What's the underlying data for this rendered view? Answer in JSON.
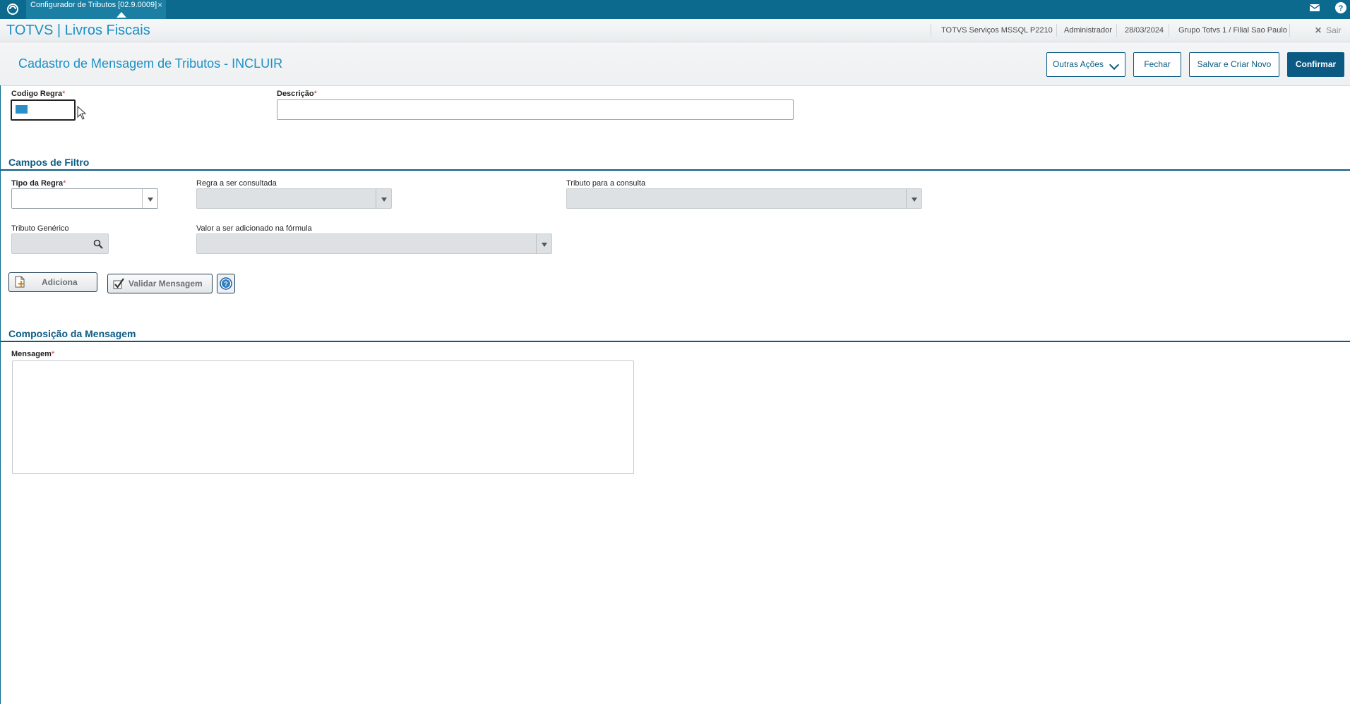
{
  "topbar": {
    "tab_label": "Configurador de Tributos [02.9.0009]",
    "tab_close": "×"
  },
  "appbar": {
    "brand": "TOTVS | Livros Fiscais",
    "environment": "TOTVS Serviços MSSQL P2210",
    "user": "Administrador",
    "date": "28/03/2024",
    "branch": "Grupo Totvs 1 / Filial Sao Paulo",
    "logout_label": "Sair",
    "logout_icon": "✕"
  },
  "titlebar": {
    "title": "Cadastro de Mensagem de Tributos - INCLUIR",
    "other_actions_label": "Outras Ações",
    "close_label": "Fechar",
    "save_new_label": "Salvar e Criar Novo",
    "confirm_label": "Confirmar"
  },
  "form": {
    "codigo_regra_label": "Codigo Regra",
    "descricao_label": "Descrição",
    "required_mark": "*"
  },
  "filters": {
    "section_title": "Campos de Filtro",
    "tipo_regra_label": "Tipo da Regra",
    "regra_consultada_label": "Regra a ser consultada",
    "tributo_consulta_label": "Tributo para a consulta",
    "tributo_generico_label": "Tributo Genérico",
    "valor_formula_label": "Valor a ser adicionado na fórmula",
    "add_button_label": "Adiciona",
    "validate_button_label": "Validar Mensagem"
  },
  "composition": {
    "section_title": "Composição da Mensagem",
    "mensagem_label": "Mensagem"
  },
  "colors": {
    "topbar": "#0b6a8e",
    "brand": "#1a8fc5",
    "primary": "#0b5a84",
    "required": "#c0392b"
  }
}
